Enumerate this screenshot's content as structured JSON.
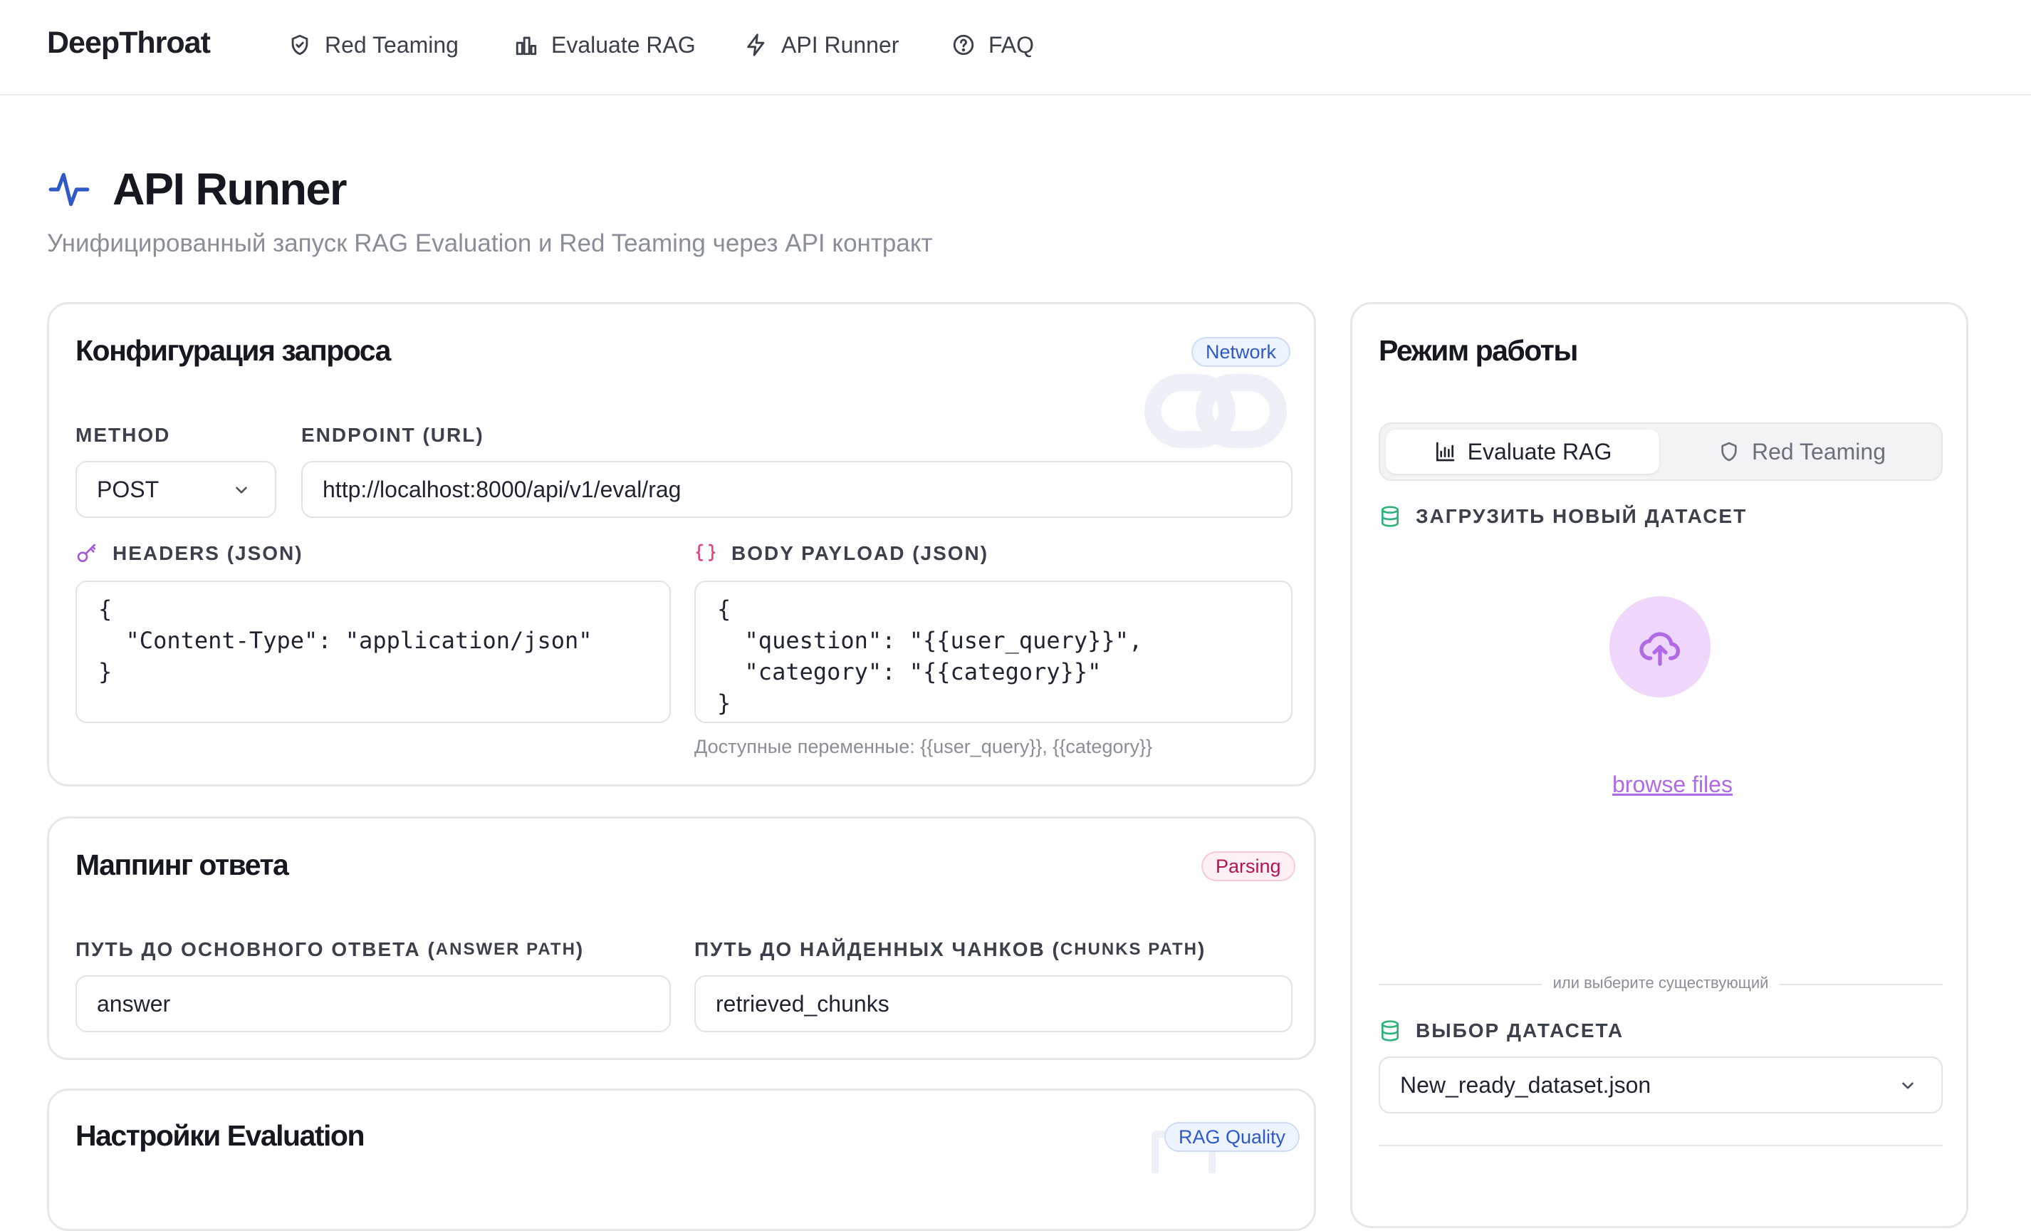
{
  "brand": "DeepThroat",
  "nav": [
    {
      "label": "Red Teaming",
      "icon": "shield-icon"
    },
    {
      "label": "Evaluate RAG",
      "icon": "bar-chart-icon"
    },
    {
      "label": "API Runner",
      "icon": "lightning-icon"
    },
    {
      "label": "FAQ",
      "icon": "help-circle-icon"
    }
  ],
  "page": {
    "title": "API Runner",
    "title_icon": "activity-icon",
    "subtitle": "Унифицированный запуск RAG Evaluation и Red Teaming через API контракт"
  },
  "request_config": {
    "title": "Конфигурация запроса",
    "badge": "Network",
    "method_label": "METHOD",
    "method_value": "POST",
    "endpoint_label": "ENDPOINT (URL)",
    "endpoint_value": "http://localhost:8000/api/v1/eval/rag",
    "headers_label": "HEADERS (JSON)",
    "headers_value": "{\n  \"Content-Type\": \"application/json\"\n}",
    "body_label": "BODY PAYLOAD (JSON)",
    "body_value": "{\n  \"question\": \"{{user_query}}\",\n  \"category\": \"{{category}}\"\n}",
    "vars_hint": "Доступные переменные: {{user_query}}, {{category}}"
  },
  "response_mapping": {
    "title": "Маппинг ответа",
    "badge": "Parsing",
    "answer_label_main": "ПУТЬ ДО ОСНОВНОГО ОТВЕТА (",
    "answer_label_sc": "ANSWER PATH",
    "answer_label_end": ")",
    "answer_value": "answer",
    "chunks_label_main": "ПУТЬ ДО НАЙДЕННЫХ ЧАНКОВ (",
    "chunks_label_sc": "CHUNKS PATH",
    "chunks_label_end": ")",
    "chunks_value": "retrieved_chunks"
  },
  "eval_settings": {
    "title": "Настройки Evaluation",
    "badge": "RAG Quality"
  },
  "mode": {
    "title": "Режим работы",
    "tab_eval": "Evaluate RAG",
    "tab_red": "Red Teaming",
    "active_tab": "Evaluate RAG",
    "upload_label": "ЗАГРУЗИТЬ НОВЫЙ ДАТАСЕТ",
    "browse": "browse files",
    "divider": "или выберите существующий",
    "select_label": "ВЫБОР ДАТАСЕТА",
    "select_value": "New_ready_dataset.json"
  },
  "colors": {
    "accent_blue": "#2e59c9",
    "accent_pink": "#b3154f",
    "upload_purple": "#b06ae6",
    "database_green": "#2fb37a"
  }
}
